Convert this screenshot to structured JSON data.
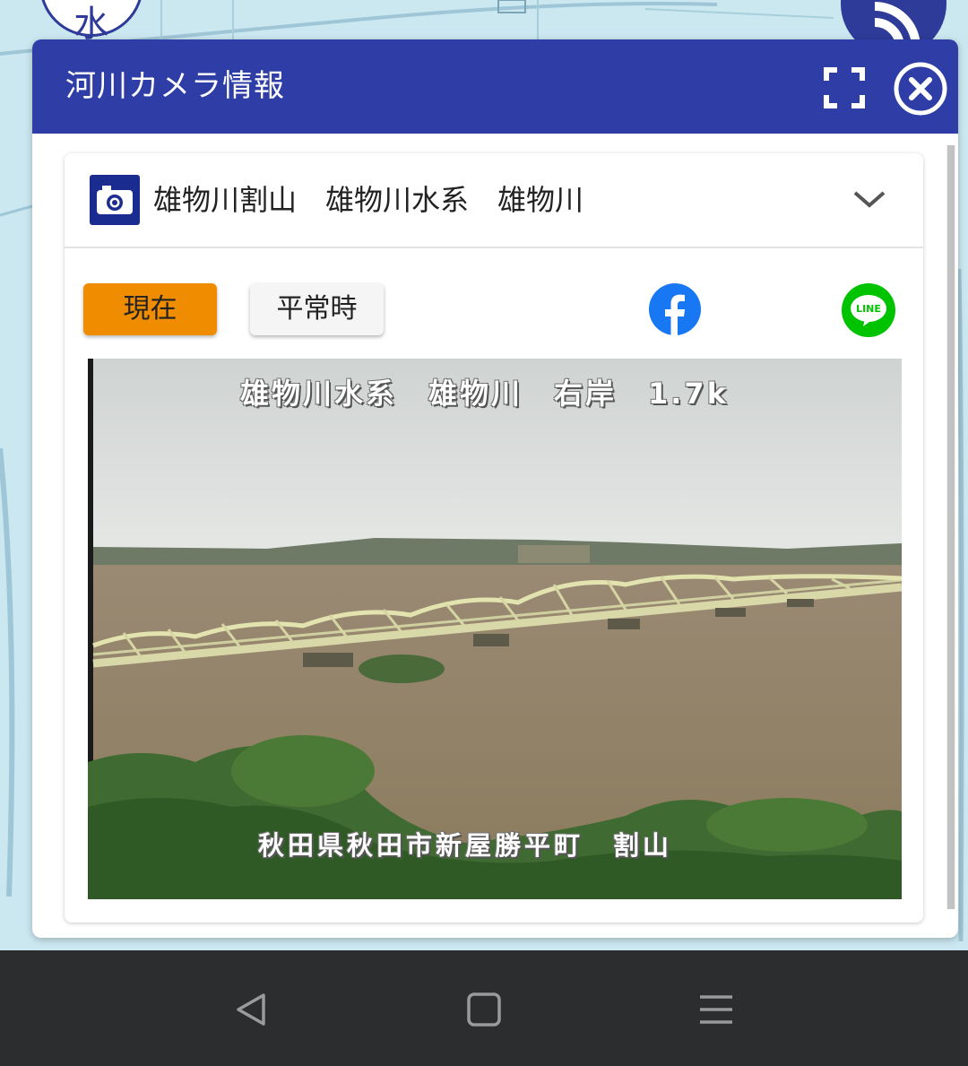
{
  "panel": {
    "title": "河川カメラ情報",
    "header_color": "#2e3ea6"
  },
  "map": {
    "left_button_label": "水",
    "right_button_icon": "rss-icon"
  },
  "card": {
    "title": "雄物川割山　雄物川水系　雄物川",
    "icon": "camera-icon",
    "chevron": "chevron-down-icon"
  },
  "tabs": {
    "current_label": "現在",
    "normal_label": "平常時",
    "current_color": "#ef8c00"
  },
  "share": {
    "facebook_icon": "facebook-icon",
    "line_label": "LINE",
    "facebook_color": "#1877f2",
    "line_color": "#00c300"
  },
  "camera_image": {
    "top_caption": "雄物川水系　雄物川　右岸　1.7k",
    "bottom_caption": "秋田県秋田市新屋勝平町　割山"
  },
  "nav": {
    "back_icon": "back-triangle-icon",
    "home_icon": "home-square-icon",
    "menu_icon": "menu-lines-icon"
  }
}
